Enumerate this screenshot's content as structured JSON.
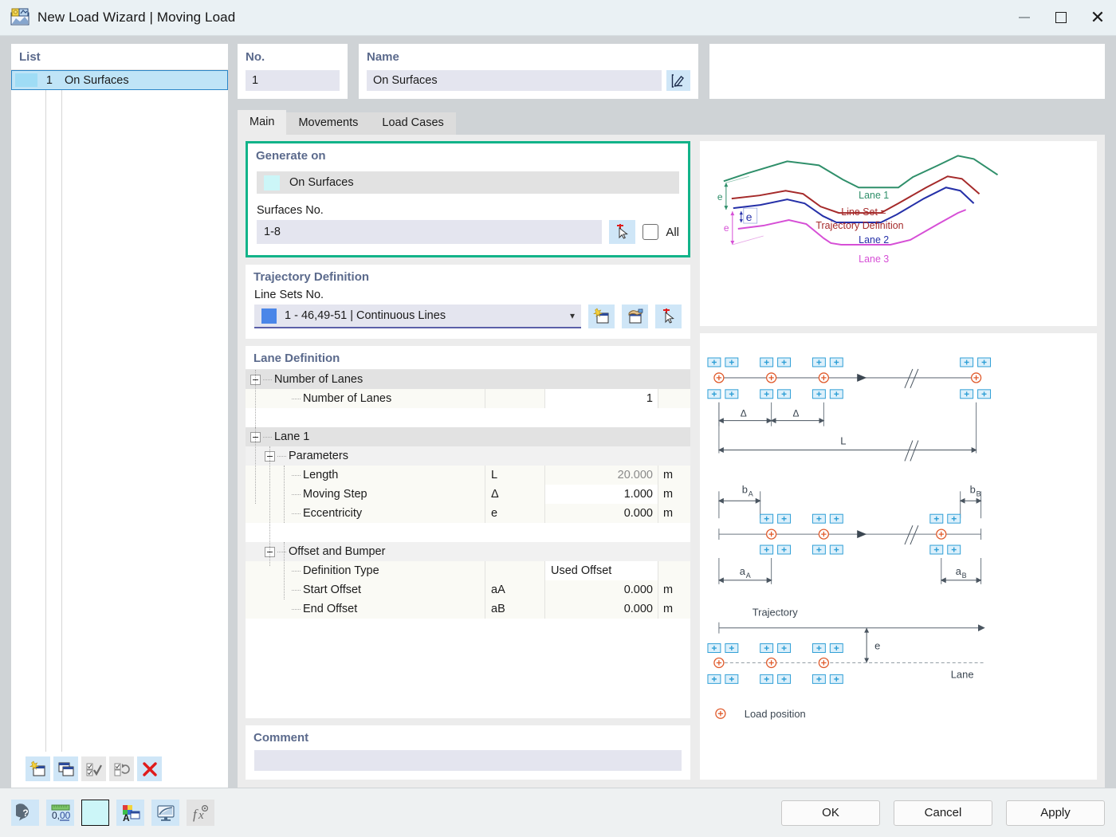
{
  "window": {
    "title": "New Load Wizard | Moving Load",
    "app_icon": "load-wizard-icon",
    "minimize": "minimize-icon",
    "maximize": "maximize-icon",
    "close": "close-icon"
  },
  "list_panel": {
    "header": "List",
    "rows": [
      {
        "color": "#9fdcf5",
        "no": "1",
        "name": "On Surfaces"
      }
    ],
    "toolbar": [
      {
        "name": "new-item-button",
        "icon": "new-window-icon"
      },
      {
        "name": "copy-item-button",
        "icon": "copy-window-icon"
      },
      {
        "name": "select-all-button",
        "icon": "check-all-icon"
      },
      {
        "name": "invert-selection-button",
        "icon": "invert-selection-icon"
      },
      {
        "name": "delete-item-button",
        "icon": "red-x-icon"
      }
    ]
  },
  "header_fields": {
    "no_label": "No.",
    "no_value": "1",
    "name_label": "Name",
    "name_value": "On Surfaces",
    "name_edit_icon": "edit-pencil-icon"
  },
  "tabs": [
    {
      "label": "Main",
      "active": true
    },
    {
      "label": "Movements",
      "active": false
    },
    {
      "label": "Load Cases",
      "active": false
    }
  ],
  "generate_on": {
    "title": "Generate on",
    "selected_item": "On Surfaces",
    "item_color": "#ccf6f8",
    "surfaces_label": "Surfaces No.",
    "surfaces_value": "1-8",
    "pick_icon": "pick-cursor-icon",
    "all_label": "All",
    "all_checked": false,
    "highlight_color": "#12b389"
  },
  "trajectory": {
    "title": "Trajectory Definition",
    "line_sets_label": "Line Sets No.",
    "line_sets_value": "1 - 46,49-51 | Continuous Lines",
    "swatch_color": "#4a86e8",
    "buttons": [
      {
        "name": "new-line-set-button",
        "icon": "new-set-icon"
      },
      {
        "name": "edit-line-set-button",
        "icon": "edit-set-icon"
      },
      {
        "name": "pick-line-set-button",
        "icon": "pick-cursor-icon"
      }
    ]
  },
  "lane_definition": {
    "title": "Lane Definition",
    "rows": [
      {
        "type": "group",
        "indent": 0,
        "label": "Number of Lanes",
        "symbol": "",
        "value": "",
        "unit": ""
      },
      {
        "type": "item",
        "indent": 2,
        "label": "Number of Lanes",
        "symbol": "",
        "value": "1",
        "unit": "",
        "value_bg": "white"
      },
      {
        "type": "spacer"
      },
      {
        "type": "group",
        "indent": 0,
        "label": "Lane 1",
        "symbol": "",
        "value": "",
        "unit": ""
      },
      {
        "type": "group2",
        "indent": 1,
        "label": "Parameters",
        "symbol": "",
        "value": "",
        "unit": ""
      },
      {
        "type": "item",
        "indent": 2,
        "label": "Length",
        "symbol": "L",
        "value": "20.000",
        "unit": "m",
        "dim": true
      },
      {
        "type": "item",
        "indent": 2,
        "label": "Moving Step",
        "symbol": "Δ",
        "value": "1.000",
        "unit": "m",
        "value_bg": "white"
      },
      {
        "type": "item",
        "indent": 2,
        "label": "Eccentricity",
        "symbol": "e",
        "value": "0.000",
        "unit": "m"
      },
      {
        "type": "spacer"
      },
      {
        "type": "group2",
        "indent": 1,
        "label": "Offset and Bumper",
        "symbol": "",
        "value": "",
        "unit": ""
      },
      {
        "type": "item",
        "indent": 2,
        "label": "Definition Type",
        "symbol": "",
        "value": "Used Offset",
        "unit": "",
        "align": "left",
        "value_bg": "white"
      },
      {
        "type": "item",
        "indent": 2,
        "label": "Start Offset",
        "symbol": "aA",
        "value": "0.000",
        "unit": "m"
      },
      {
        "type": "item",
        "indent": 2,
        "label": "End Offset",
        "symbol": "aB",
        "value": "0.000",
        "unit": "m"
      },
      {
        "type": "spacer"
      }
    ]
  },
  "comment": {
    "title": "Comment",
    "value": ""
  },
  "diagram_top": {
    "lanes": [
      {
        "label": "Lane 1",
        "color": "#2f8f6a"
      },
      {
        "label": "Lane 2",
        "color": "#2530a8"
      },
      {
        "label": "Lane 3",
        "color": "#d64fd6"
      }
    ],
    "line_set_label_1": "Line Set =",
    "line_set_label_2": "Trajectory Definition",
    "line_set_color": "#a52a2a",
    "eccentricity_symbol": "e"
  },
  "diagram_bottom": {
    "delta_symbol": "Δ",
    "length_symbol": "L",
    "bA": "b",
    "bA_sub": "A",
    "bB": "b",
    "bB_sub": "B",
    "aA": "a",
    "aA_sub": "A",
    "aB": "a",
    "aB_sub": "B",
    "trajectory_label": "Trajectory",
    "lane_label": "Lane",
    "eccentricity_symbol": "e",
    "legend_label": "Load position",
    "load_marker_color": "#e05a2b",
    "plate_color": "#2f9fd6"
  },
  "status_bar": {
    "buttons": [
      {
        "name": "help-button",
        "icon": "help-bubble-icon"
      },
      {
        "name": "units-button",
        "icon": "units-decimal-icon"
      },
      {
        "name": "color-button",
        "icon": "color-swatch-icon"
      },
      {
        "name": "display-properties-button",
        "icon": "display-props-icon"
      },
      {
        "name": "visibility-button",
        "icon": "monitor-icon"
      },
      {
        "name": "formula-button",
        "icon": "fx-icon"
      }
    ]
  },
  "dialog_buttons": {
    "ok": "OK",
    "cancel": "Cancel",
    "apply": "Apply"
  }
}
